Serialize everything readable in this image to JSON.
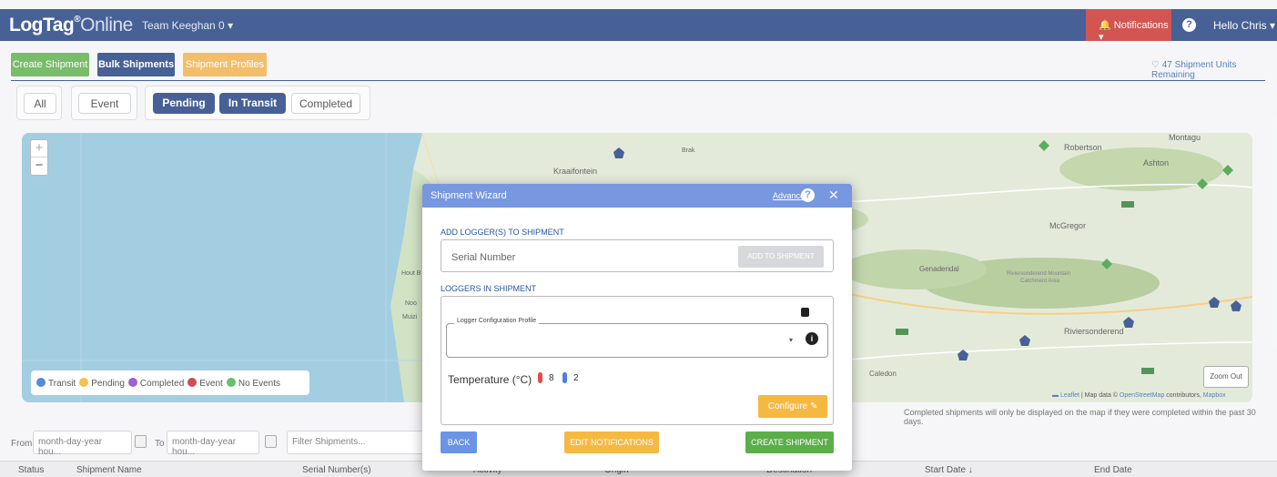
{
  "header": {
    "logo_bold": "LogTag",
    "logo_sup": "®",
    "logo_thin": "Online",
    "team": "Team Keeghan 0 ▾",
    "notifications": "🔔 Notifications ▾",
    "help": "?",
    "user": "Hello Chris ▾",
    "notif_color": "#c9302c",
    "brand_color": "#1f3f7f"
  },
  "actions": {
    "create": "Create Shipment",
    "bulk": "Bulk Shipments",
    "profiles": "Shipment Profiles",
    "units_remaining": "♡ 47 Shipment Units Remaining"
  },
  "filters": {
    "all": "All",
    "event": "Event",
    "pending": "Pending",
    "in_transit": "In Transit",
    "completed": "Completed"
  },
  "map": {
    "zoom_in": "+",
    "zoom_out": "−",
    "zoom_out_button": "Zoom Out",
    "places": {
      "kraaifontein": "Kraaifontein",
      "robertson": "Robertson",
      "montagu": "Montagu",
      "ashton": "Ashton",
      "mcgregor": "McGregor",
      "genadendal": "Genadendal",
      "riversonderend_mountain": "Riviersonderend Mountain",
      "catchment_area": "Catchment Area",
      "riviersonderend": "Riviersonderend",
      "caledon": "Caledon",
      "hout_bay": "Hout B",
      "noo": "Noo",
      "muizenberg": "Muizi",
      "brak": "Brak"
    },
    "legend": [
      {
        "label": "Transit",
        "color": "#2f6fd6"
      },
      {
        "label": "Pending",
        "color": "#f0b429"
      },
      {
        "label": "Completed",
        "color": "#8e3bc9"
      },
      {
        "label": "Event",
        "color": "#c62828"
      },
      {
        "label": "No Events",
        "color": "#4caf50"
      }
    ],
    "attribution_leaflet": "▬ Leaflet",
    "attribution_text": " | Map data © ",
    "attribution_osm": "OpenStreetMap",
    "attribution_contrib": " contributors, ",
    "attribution_mapbox": "Mapbox"
  },
  "note": "Completed shipments will only be displayed on the map if they were completed within the past 30 days.",
  "date_filter": {
    "from_label": "From",
    "from_placeholder": "month-day-year hou...",
    "to_label": "To",
    "to_placeholder": "month-day-year hou...",
    "filter_placeholder": "Filter Shipments..."
  },
  "table": {
    "columns": [
      "Status",
      "Shipment Name",
      "Serial Number(s)",
      "Activity",
      "Origin",
      "Destination",
      "Start Date ↓",
      "End Date"
    ]
  },
  "modal": {
    "title": "Shipment Wizard",
    "advanced": "Advanced",
    "help": "?",
    "close": "✕",
    "add_section": "ADD LOGGER(S) TO SHIPMENT",
    "serial_placeholder": "Serial Number",
    "add_button": "ADD TO SHIPMENT",
    "loggers_section": "LOGGERS IN SHIPMENT",
    "profile_label": "Logger Configuration Profile",
    "profile_value": "",
    "caret": "▾",
    "info": "i",
    "temperature_label": "Temperature (°C)",
    "temp_high": "8",
    "temp_low": "2",
    "configure": "Configure ✎",
    "back": "BACK",
    "edit_notifications": "EDIT NOTIFICATIONS",
    "create_shipment": "CREATE SHIPMENT"
  }
}
